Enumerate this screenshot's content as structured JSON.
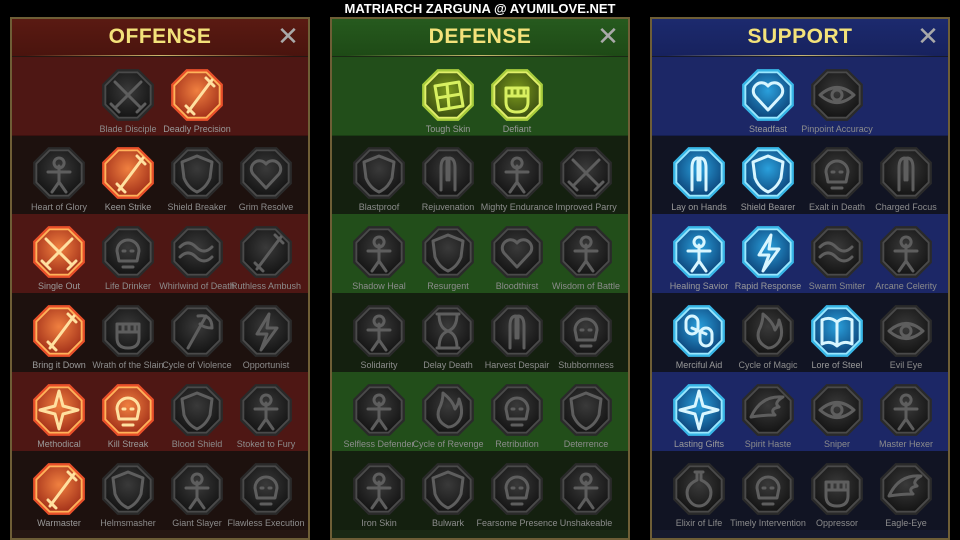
{
  "header": {
    "title": "MATRIARCH ZARGUNA @ AYUMILOVE.NET"
  },
  "colors": {
    "offense_active": "#e8502a",
    "defense_active": "#a8cc3c",
    "support_active": "#38b6e6",
    "inactive_label": "#8c8c8c",
    "panel_title": "#f3e27a"
  },
  "panels": [
    {
      "title": "OFFENSE",
      "close": "✕",
      "theme": "offense",
      "rows": [
        [
          {
            "name": "Blade Disciple",
            "active": false,
            "icon": "crossed-swords-icon"
          },
          {
            "name": "Deadly Precision",
            "active": true,
            "icon": "dagger-icon"
          }
        ],
        [
          {
            "name": "Heart of Glory",
            "active": false,
            "icon": "demon-icon"
          },
          {
            "name": "Keen Strike",
            "active": true,
            "icon": "slash-strike-icon"
          },
          {
            "name": "Shield Breaker",
            "active": false,
            "icon": "broken-shield-icon"
          },
          {
            "name": "Grim Resolve",
            "active": false,
            "icon": "broken-heart-icon"
          }
        ],
        [
          {
            "name": "Single Out",
            "active": true,
            "icon": "arrows-target-icon"
          },
          {
            "name": "Life Drinker",
            "active": false,
            "icon": "fangs-icon"
          },
          {
            "name": "Whirlwind of Death",
            "active": false,
            "icon": "whirlwind-icon"
          },
          {
            "name": "Ruthless Ambush",
            "active": false,
            "icon": "ambush-blade-icon"
          }
        ],
        [
          {
            "name": "Bring it Down",
            "active": true,
            "icon": "hand-sword-icon"
          },
          {
            "name": "Wrath of the Slain",
            "active": false,
            "icon": "fist-icon"
          },
          {
            "name": "Cycle of Violence",
            "active": false,
            "icon": "axe-icon"
          },
          {
            "name": "Opportunist",
            "active": false,
            "icon": "chain-lightning-icon"
          }
        ],
        [
          {
            "name": "Methodical",
            "active": true,
            "icon": "burst-blades-icon"
          },
          {
            "name": "Kill Streak",
            "active": true,
            "icon": "skull-icon"
          },
          {
            "name": "Blood Shield",
            "active": false,
            "icon": "sword-shield-icon"
          },
          {
            "name": "Stoked to Fury",
            "active": false,
            "icon": "berserker-icon"
          }
        ],
        [
          {
            "name": "Warmaster",
            "active": true,
            "icon": "sparkle-sword-icon"
          },
          {
            "name": "Helmsmasher",
            "active": false,
            "icon": "helmet-icon"
          },
          {
            "name": "Giant Slayer",
            "active": false,
            "icon": "giant-icon"
          },
          {
            "name": "Flawless Execution",
            "active": false,
            "icon": "skull-crown-icon"
          }
        ]
      ]
    },
    {
      "title": "DEFENSE",
      "close": "✕",
      "theme": "defense",
      "rows": [
        [
          {
            "name": "Tough Skin",
            "active": true,
            "icon": "armor-plates-icon"
          },
          {
            "name": "Defiant",
            "active": true,
            "icon": "raised-fist-icon"
          }
        ],
        [
          {
            "name": "Blastproof",
            "active": false,
            "icon": "chevron-armor-icon"
          },
          {
            "name": "Rejuvenation",
            "active": false,
            "icon": "healing-hand-icon"
          },
          {
            "name": "Mighty Endurance",
            "active": false,
            "icon": "muscle-icon"
          },
          {
            "name": "Improved Parry",
            "active": false,
            "icon": "parry-blades-icon"
          }
        ],
        [
          {
            "name": "Shadow Heal",
            "active": false,
            "icon": "shadow-figure-icon"
          },
          {
            "name": "Resurgent",
            "active": false,
            "icon": "knight-icon"
          },
          {
            "name": "Bloodthirst",
            "active": false,
            "icon": "skull-heart-icon"
          },
          {
            "name": "Wisdom of Battle",
            "active": false,
            "icon": "sage-icon"
          }
        ],
        [
          {
            "name": "Solidarity",
            "active": false,
            "icon": "crowd-icon"
          },
          {
            "name": "Delay Death",
            "active": false,
            "icon": "hourglass-icon"
          },
          {
            "name": "Harvest Despair",
            "active": false,
            "icon": "open-hand-icon"
          },
          {
            "name": "Stubbornness",
            "active": false,
            "icon": "bull-icon"
          }
        ],
        [
          {
            "name": "Selfless Defender",
            "active": false,
            "icon": "defender-icon"
          },
          {
            "name": "Cycle of Revenge",
            "active": false,
            "icon": "flames-icon"
          },
          {
            "name": "Retribution",
            "active": false,
            "icon": "spiked-skull-icon"
          },
          {
            "name": "Deterrence",
            "active": false,
            "icon": "deflect-icon"
          }
        ],
        [
          {
            "name": "Iron Skin",
            "active": false,
            "icon": "iron-body-icon"
          },
          {
            "name": "Bulwark",
            "active": false,
            "icon": "bulwark-shield-icon"
          },
          {
            "name": "Fearsome Presence",
            "active": false,
            "icon": "fearsome-face-icon"
          },
          {
            "name": "Unshakeable",
            "active": false,
            "icon": "strongman-icon"
          }
        ]
      ]
    },
    {
      "title": "SUPPORT",
      "close": "✕",
      "theme": "support",
      "rows": [
        [
          {
            "name": "Steadfast",
            "active": true,
            "icon": "heart-sparkle-icon"
          },
          {
            "name": "Pinpoint Accuracy",
            "active": false,
            "icon": "pinpoint-icon"
          }
        ],
        [
          {
            "name": "Lay on Hands",
            "active": true,
            "icon": "praying-hands-icon"
          },
          {
            "name": "Shield Bearer",
            "active": true,
            "icon": "radiant-shield-icon"
          },
          {
            "name": "Exalt in Death",
            "active": false,
            "icon": "ghost-skull-icon"
          },
          {
            "name": "Charged Focus",
            "active": false,
            "icon": "charged-hand-icon"
          }
        ],
        [
          {
            "name": "Healing Savior",
            "active": true,
            "icon": "healing-figure-icon"
          },
          {
            "name": "Rapid Response",
            "active": true,
            "icon": "lightning-icon"
          },
          {
            "name": "Swarm Smiter",
            "active": false,
            "icon": "swarm-icon"
          },
          {
            "name": "Arcane Celerity",
            "active": false,
            "icon": "speed-figure-icon"
          }
        ],
        [
          {
            "name": "Merciful Aid",
            "active": true,
            "icon": "chained-heart-icon"
          },
          {
            "name": "Cycle of Magic",
            "active": false,
            "icon": "comet-icon"
          },
          {
            "name": "Lore of Steel",
            "active": true,
            "icon": "book-icon"
          },
          {
            "name": "Evil Eye",
            "active": false,
            "icon": "evil-eye-icon"
          }
        ],
        [
          {
            "name": "Lasting Gifts",
            "active": true,
            "icon": "compass-star-icon"
          },
          {
            "name": "Spirit Haste",
            "active": false,
            "icon": "winged-boot-icon"
          },
          {
            "name": "Sniper",
            "active": false,
            "icon": "eye-target-icon"
          },
          {
            "name": "Master Hexer",
            "active": false,
            "icon": "hex-figure-icon"
          }
        ],
        [
          {
            "name": "Elixir of Life",
            "active": false,
            "icon": "potion-icon"
          },
          {
            "name": "Timely Intervention",
            "active": false,
            "icon": "skull-clock-icon"
          },
          {
            "name": "Oppressor",
            "active": false,
            "icon": "claw-fist-icon"
          },
          {
            "name": "Eagle-Eye",
            "active": false,
            "icon": "eagle-icon"
          }
        ]
      ]
    }
  ]
}
